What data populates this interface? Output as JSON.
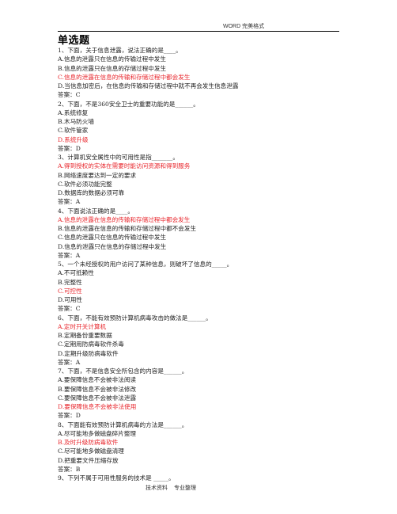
{
  "header": {
    "text": "WORD 完美格式"
  },
  "section_title": "单选题",
  "colors": {
    "correct_option": "#e8262c",
    "text": "#222222"
  },
  "questions": [
    {
      "stem": "1、下面，关于信息泄露，说法正确的是____。",
      "options": [
        {
          "text": "A.信息的泄露只在信息的传输过程中发生",
          "correct": false
        },
        {
          "text": "B.信息的泄露只在信息的存储过程中发生",
          "correct": false
        },
        {
          "text": "C.信息的泄露在信息的传输和存储过程中都会发生",
          "correct": true
        },
        {
          "text": "D.当信息加密后，在信息的传输和存储过程中就不再会发生信息泄露",
          "correct": false
        }
      ],
      "answer": "答案：C"
    },
    {
      "stem": "2、下面，不是360安全卫士的重要功能的是______。",
      "options": [
        {
          "text": "A.系统修复",
          "correct": false
        },
        {
          "text": "B.木马防火墙",
          "correct": false
        },
        {
          "text": "C.软件管家",
          "correct": false
        },
        {
          "text": "D.系统升级",
          "correct": true
        }
      ],
      "answer": "答案：D"
    },
    {
      "stem": "3、计算机安全属性中的可用性是指_______。",
      "options": [
        {
          "text": "A.得到授权的实体在需要时能访问资源和得到服务",
          "correct": true
        },
        {
          "text": "B.网络速度要达到一定的要求",
          "correct": false
        },
        {
          "text": "C.软件必须功能完整",
          "correct": false
        },
        {
          "text": "D.数据库的数据必须可靠",
          "correct": false
        }
      ],
      "answer": "答案：A"
    },
    {
      "stem": "4、下面说法正确的是____。",
      "options": [
        {
          "text": "A.信息的泄露在信息的传输和存储过程中都会发生",
          "correct": true
        },
        {
          "text": "B.信息的泄露在信息的传输和存储过程中都不会发生",
          "correct": false
        },
        {
          "text": "C.信息的泄露只在信息的传输过程中发生",
          "correct": false
        },
        {
          "text": "D.信息的泄露只在信息的存储过程中发生",
          "correct": false
        }
      ],
      "answer": "答案：A"
    },
    {
      "stem": "5、一个未经授权的用户访问了某种信息，则破坏了信息的_____。",
      "options": [
        {
          "text": "A.不可抵赖性",
          "correct": false
        },
        {
          "text": "B.完整性",
          "correct": false
        },
        {
          "text": "C.可控性",
          "correct": true
        },
        {
          "text": "D.可用性",
          "correct": false
        }
      ],
      "answer": "答案：C"
    },
    {
      "stem": "6、下面，不能有效预防计算机病毒攻击的做法是______。",
      "options": [
        {
          "text": "A.定时开关计算机",
          "correct": true
        },
        {
          "text": "B.定期备份重要数据",
          "correct": false
        },
        {
          "text": "C.定期用防病毒软件杀毒",
          "correct": false
        },
        {
          "text": "D.定期升级防病毒软件",
          "correct": false
        }
      ],
      "answer": "答案：A"
    },
    {
      "stem": "7、下面，不是信息安全所包含的内容是______。",
      "options": [
        {
          "text": "A.要保障信息不会被非法阅读",
          "correct": false
        },
        {
          "text": "B.要保障信息不会被非法修改",
          "correct": false
        },
        {
          "text": "C.要保障信息不会被非法泄露",
          "correct": false
        },
        {
          "text": "D.要保障信息不会被非法使用",
          "correct": true
        }
      ],
      "answer": "答案：D"
    },
    {
      "stem": "8、下面能有效预防计算机病毒的方法是______。",
      "options": [
        {
          "text": "A.尽可能地多做磁盘碎片整理",
          "correct": false
        },
        {
          "text": "B.及时升级防病毒软件",
          "correct": true
        },
        {
          "text": "C.尽可能地多做磁盘清理",
          "correct": false
        },
        {
          "text": "D.把重要文件压缩存放",
          "correct": false
        }
      ],
      "answer": "答案：B"
    },
    {
      "stem": "9、下列不属于可用性服务的技术是 _____。",
      "options": [],
      "answer": null
    }
  ],
  "footer": {
    "text": "技术资料 专业整理"
  }
}
